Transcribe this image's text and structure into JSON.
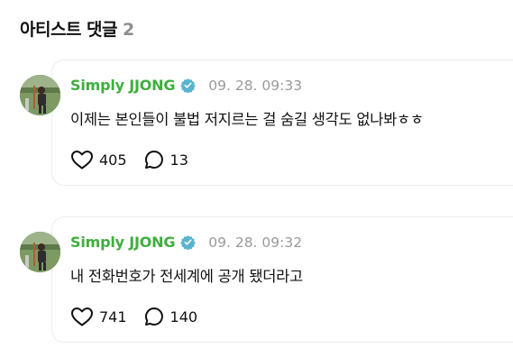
{
  "section": {
    "title": "아티스트 댓글",
    "count": "2"
  },
  "comments": [
    {
      "author": "Simply JJONG",
      "verified_icon": "verified-badge-icon",
      "timestamp": "09. 28. 09:33",
      "body": "이제는 본인들이 불법 저지르는 걸 숨길 생각도 없나봐ㅎㅎ",
      "likes": "405",
      "replies": "13"
    },
    {
      "author": "Simply JJONG",
      "verified_icon": "verified-badge-icon",
      "timestamp": "09. 28. 09:32",
      "body": "내 전화번호가 전세계에 공개 됐더라고",
      "likes": "741",
      "replies": "140"
    }
  ],
  "colors": {
    "author": "#3fae3f",
    "verified": "#5ab4cf",
    "timestamp": "#9a9a9a",
    "count": "#8e8e8e"
  }
}
